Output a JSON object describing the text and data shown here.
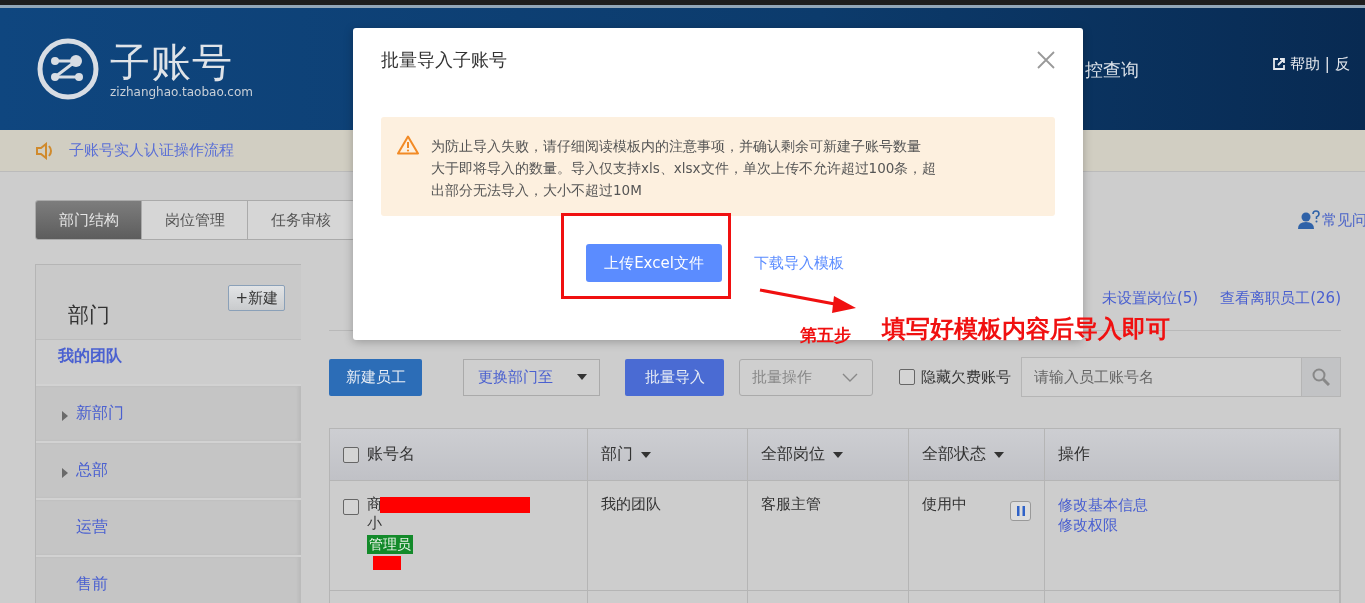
{
  "header": {
    "logo_title": "子账号",
    "logo_domain": "zizhanghao.taobao.com",
    "nav_item": "控查询",
    "help": "帮助 | 反"
  },
  "notice": {
    "text": "子账号实人认证操作流程"
  },
  "tabs": [
    {
      "label": "部门结构",
      "selected": true
    },
    {
      "label": "岗位管理",
      "selected": false
    },
    {
      "label": "任务审核",
      "selected": false
    }
  ],
  "faq_link": "常见问",
  "department_panel": {
    "title": "部门",
    "new_button": "+新建",
    "items": [
      {
        "label": "我的团队",
        "selected": true,
        "expandable": false
      },
      {
        "label": "新部门",
        "selected": false,
        "expandable": true
      },
      {
        "label": "总部",
        "selected": false,
        "expandable": true
      },
      {
        "label": "运营",
        "selected": false,
        "expandable": false
      },
      {
        "label": "售前",
        "selected": false,
        "expandable": false
      }
    ]
  },
  "links": [
    "未设置岗位(5)",
    "查看离职员工(26)"
  ],
  "toolbar": {
    "new_button": "新建员工",
    "move_dropdown": "更换部门至",
    "import_button": "批量导入",
    "batch_select": "批量操作",
    "hide_overdue": {
      "label": "隐藏欠费账号",
      "checked": false
    },
    "search": {
      "placeholder": "请输入员工账号名"
    }
  },
  "table": {
    "select_all_checked": false,
    "columns": [
      {
        "label": "账号名",
        "has_menu": false
      },
      {
        "label": "部门",
        "has_menu": true
      },
      {
        "label": "全部岗位",
        "has_menu": true
      },
      {
        "label": "全部状态",
        "has_menu": true
      },
      {
        "label": "操作",
        "has_menu": false
      }
    ],
    "rows": [
      {
        "checked": false,
        "name_lines": [
          "商",
          "小"
        ],
        "badge": "管理员",
        "department": "我的团队",
        "position": "客服主管",
        "status": "使用中",
        "actions": [
          "修改基本信息",
          "修改权限"
        ]
      }
    ]
  },
  "dialog": {
    "title": "批量导入子账号",
    "warning_lines": [
      "为防止导入失败，请仔细阅读模板内的注意事项，并确认剩余可新建子账号数量",
      "大于即将导入的数量。导入仅支持xls、xlsx文件，单次上传不允许超过100条，超",
      "出部分无法导入，大小不超过10M"
    ],
    "upload_button": "上传Excel文件",
    "download_link": "下载导入模板"
  },
  "annotation": {
    "step": "第五步",
    "text": "填写好模板内容后导入即可"
  }
}
